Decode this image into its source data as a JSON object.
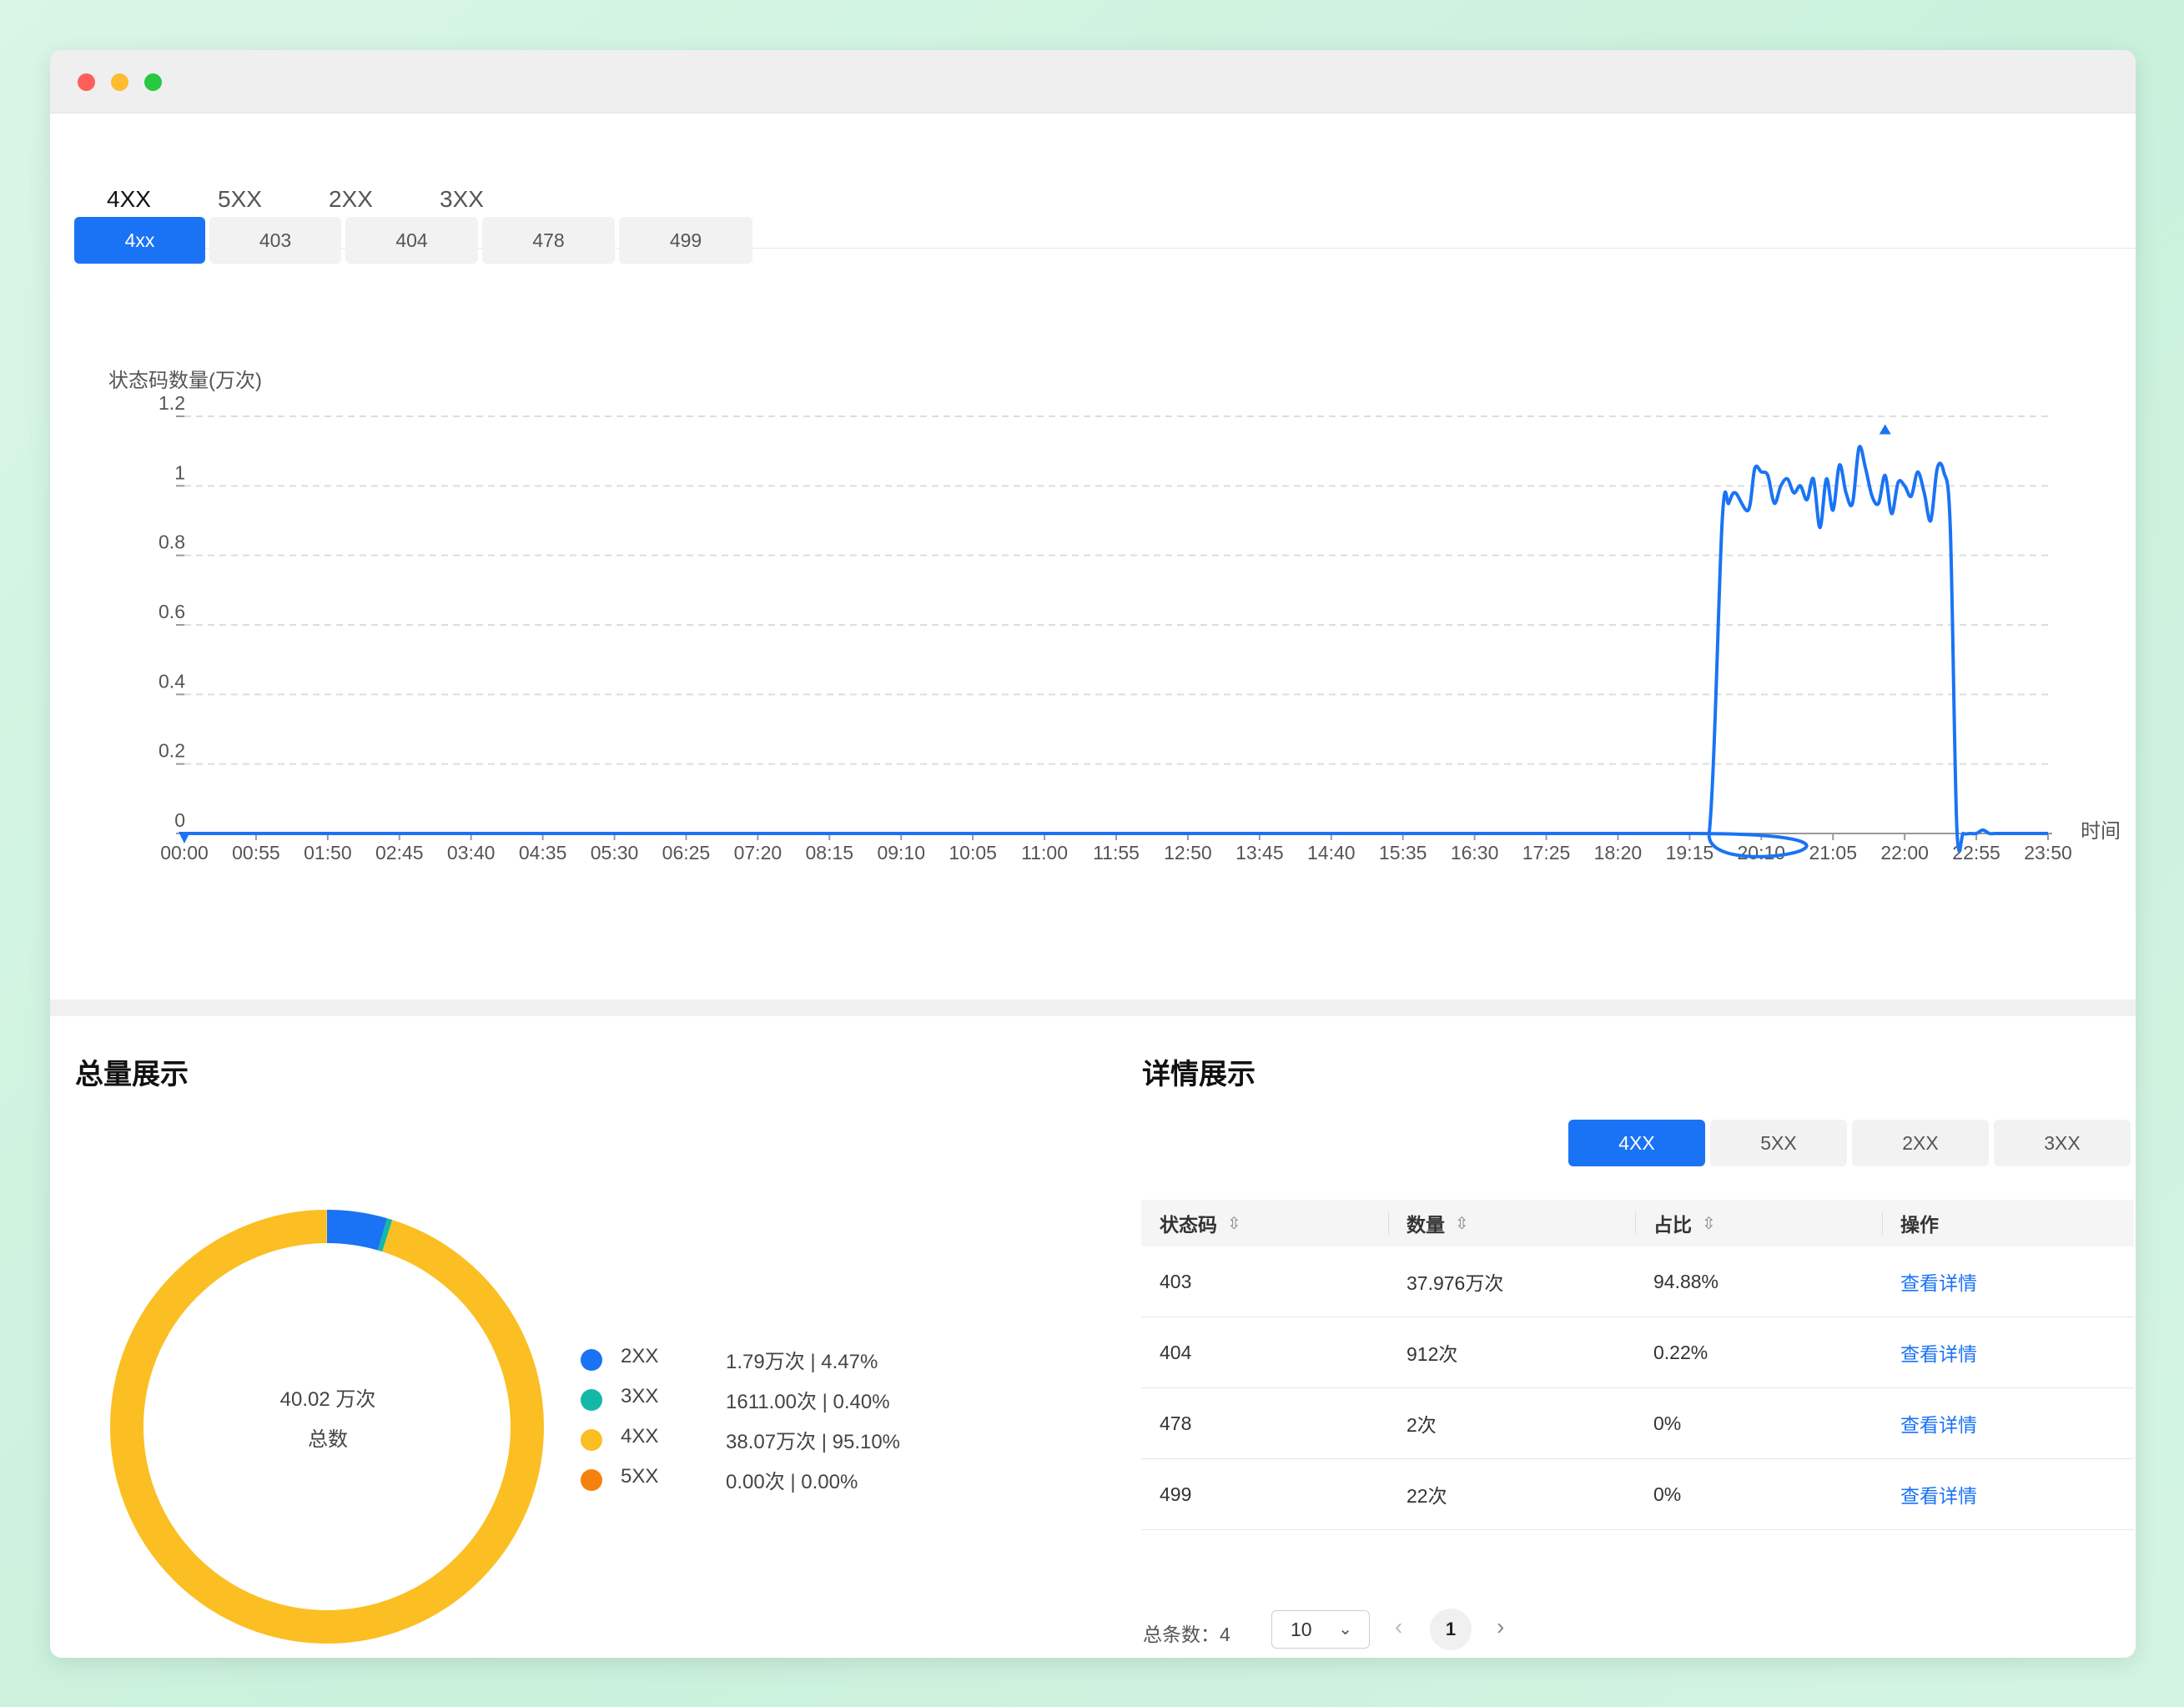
{
  "top_tabs": [
    {
      "label": "4XX",
      "active": true
    },
    {
      "label": "5XX",
      "active": false
    },
    {
      "label": "2XX",
      "active": false
    },
    {
      "label": "3XX",
      "active": false
    }
  ],
  "code_buttons": [
    {
      "label": "4xx",
      "active": true
    },
    {
      "label": "403",
      "active": false
    },
    {
      "label": "404",
      "active": false
    },
    {
      "label": "478",
      "active": false
    },
    {
      "label": "499",
      "active": false
    }
  ],
  "chart_data": {
    "type": "line",
    "ylabel": "状态码数量(万次)",
    "xlabel": "时间",
    "ylim": [
      0,
      1.2
    ],
    "yticks": [
      "1.2",
      "1",
      "0.8",
      "0.6",
      "0.4",
      "0.2",
      "0"
    ],
    "xticks": [
      "00:00",
      "00:55",
      "01:50",
      "02:45",
      "03:40",
      "04:35",
      "05:30",
      "06:25",
      "07:20",
      "08:15",
      "09:10",
      "10:05",
      "11:00",
      "11:55",
      "12:50",
      "13:45",
      "14:40",
      "15:35",
      "16:30",
      "17:25",
      "18:20",
      "19:15",
      "20:10",
      "21:05",
      "22:00",
      "22:55",
      "23:50"
    ],
    "grid": true,
    "color": "#1a73f5",
    "series": [
      {
        "x": [
          "00:00",
          "19:15",
          "19:30",
          "19:40",
          "19:45",
          "19:50",
          "20:00",
          "20:05",
          "20:10",
          "20:15",
          "20:20",
          "20:25",
          "20:30",
          "20:35",
          "20:40",
          "20:45",
          "20:50",
          "20:55",
          "21:00",
          "21:05",
          "21:10",
          "21:15",
          "21:20",
          "21:25",
          "21:30",
          "21:35",
          "21:40",
          "21:45",
          "21:50",
          "21:55",
          "22:00",
          "22:05",
          "22:10",
          "22:15",
          "22:20",
          "22:25",
          "22:30",
          "22:35",
          "22:40",
          "22:45",
          "22:50",
          "22:55",
          "23:00",
          "23:05",
          "23:10",
          "23:15",
          "23:20",
          "23:25",
          "23:30",
          "23:35",
          "23:40",
          "23:45",
          "23:50"
        ],
        "values": [
          0,
          0,
          0,
          0.9,
          0.95,
          0.98,
          0.93,
          1.05,
          1.04,
          1.03,
          0.95,
          1.0,
          1.02,
          0.98,
          1.0,
          0.96,
          1.02,
          0.88,
          1.02,
          0.93,
          1.06,
          0.98,
          0.95,
          1.11,
          1.05,
          0.97,
          0.95,
          1.03,
          0.92,
          1.01,
          1.0,
          0.97,
          1.04,
          0.98,
          0.9,
          1.05,
          1.04,
          0.88,
          0.02,
          0.0,
          0.0,
          0.0,
          0.01,
          0.0,
          0.0,
          0.0,
          0.0,
          0.0,
          0.0,
          0.0,
          0.0,
          0.0,
          0.0
        ]
      }
    ],
    "markers": [
      {
        "kind": "max",
        "x": "21:45",
        "value": 1.11
      },
      {
        "kind": "min",
        "x": "00:00",
        "value": 0
      }
    ]
  },
  "summary": {
    "title": "总量展示",
    "total_value": "40.02 万次",
    "total_label": "总数",
    "donut": [
      {
        "name": "2XX",
        "value_text": "1.79万次 | 4.47%",
        "percent": 4.47,
        "color": "#1a73f5"
      },
      {
        "name": "3XX",
        "value_text": "1611.00次 | 0.40%",
        "percent": 0.4,
        "color": "#14b8a6"
      },
      {
        "name": "4XX",
        "value_text": "38.07万次 | 95.10%",
        "percent": 95.1,
        "color": "#fbbf24"
      },
      {
        "name": "5XX",
        "value_text": "0.00次 | 0.00%",
        "percent": 0.0,
        "color": "#f5820d"
      }
    ]
  },
  "details": {
    "title": "详情展示",
    "tabs": [
      {
        "label": "4XX",
        "active": true
      },
      {
        "label": "5XX",
        "active": false
      },
      {
        "label": "2XX",
        "active": false
      },
      {
        "label": "3XX",
        "active": false
      }
    ],
    "columns": [
      "状态码",
      "数量",
      "占比",
      "操作"
    ],
    "rows": [
      {
        "code": "403",
        "count": "37.976万次",
        "ratio": "94.88%",
        "action": "查看详情"
      },
      {
        "code": "404",
        "count": "912次",
        "ratio": "0.22%",
        "action": "查看详情"
      },
      {
        "code": "478",
        "count": "2次",
        "ratio": "0%",
        "action": "查看详情"
      },
      {
        "code": "499",
        "count": "22次",
        "ratio": "0%",
        "action": "查看详情"
      }
    ],
    "pagination": {
      "total_label": "总条数：4",
      "page_size": "10",
      "current_page": "1"
    }
  }
}
